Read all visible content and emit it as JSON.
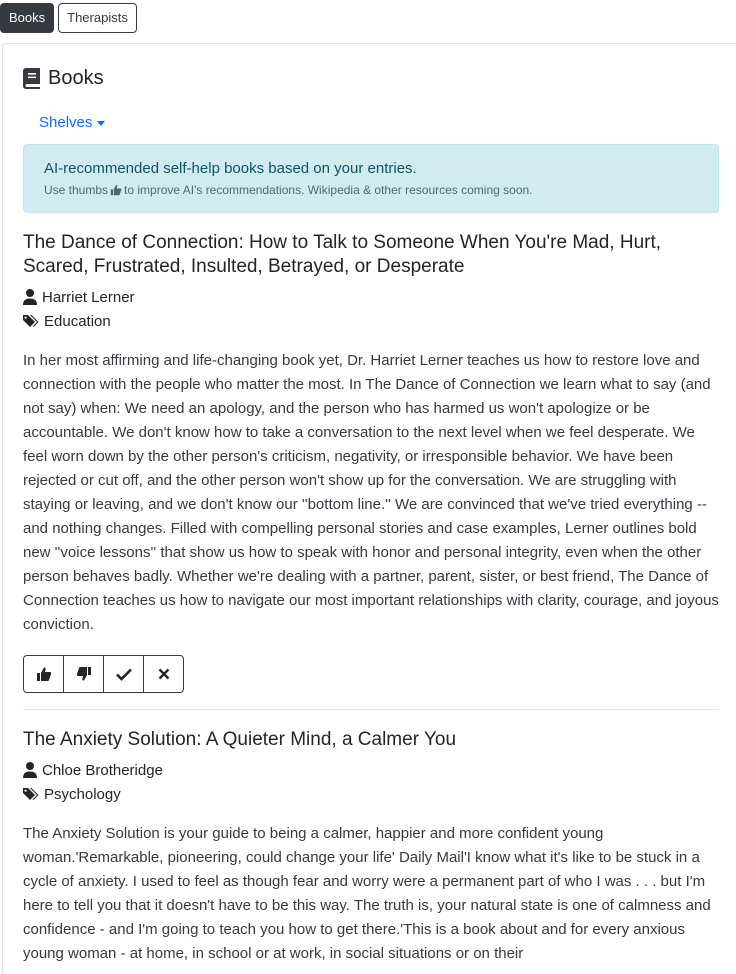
{
  "nav": {
    "tabs": [
      {
        "label": "Books"
      },
      {
        "label": "Therapists"
      }
    ]
  },
  "section": {
    "title": "Books",
    "shelves_label": "Shelves"
  },
  "alert": {
    "main": "AI-recommended self-help books based on your entries.",
    "sub_prefix": "Use thumbs",
    "sub_suffix": "to improve AI's recommendations. Wikipedia & other resources coming soon."
  },
  "books": [
    {
      "title": "The Dance of Connection: How to Talk to Someone When You're Mad, Hurt, Scared, Frustrated, Insulted, Betrayed, or Desperate",
      "author": "Harriet Lerner",
      "category": "Education",
      "description": "In her most affirming and life-changing book yet, Dr. Harriet Lerner teaches us how to restore love and connection with the people who matter the most. In The Dance of Connection we learn what to say (and not say) when: We need an apology, and the person who has harmed us won't apologize or be accountable. We don't know how to take a conversation to the next level when we feel desperate. We feel worn down by the other person's criticism, negativity, or irresponsible behavior. We have been rejected or cut off, and the other person won't show up for the conversation. We are struggling with staying or leaving, and we don't know our ''bottom line.'' We are convinced that we've tried everything -- and nothing changes. Filled with compelling personal stories and case examples, Lerner outlines bold new ''voice lessons'' that show us how to speak with honor and personal integrity, even when the other person behaves badly. Whether we're dealing with a partner, parent, sister, or best friend, The Dance of Connection teaches us how to navigate our most important relationships with clarity, courage, and joyous conviction."
    },
    {
      "title": "The Anxiety Solution: A Quieter Mind, a Calmer You",
      "author": "Chloe Brotheridge",
      "category": "Psychology",
      "description": "The Anxiety Solution is your guide to being a calmer, happier and more confident young woman.'Remarkable, pioneering, could change your life' Daily Mail'I know what it's like to be stuck in a cycle of anxiety. I used to feel as though fear and worry were a permanent part of who I was . . . but I'm here to tell you that it doesn't have to be this way. The truth is, your natural state is one of calmness and confidence - and I'm going to teach you how to get there.'This is a book about and for every anxious young woman - at home, in school or at work, in social situations or on their"
    }
  ],
  "icons": {
    "book": "book-icon",
    "user": "user-icon",
    "tags": "tags-icon",
    "thumbs_up": "thumbs-up-icon",
    "thumbs_down": "thumbs-down-icon",
    "check": "check-icon",
    "close": "close-icon"
  },
  "colors": {
    "dark": "#343a40",
    "link": "#0d6efd",
    "alert_bg": "#d1ecf1",
    "alert_text": "#0c5460"
  }
}
